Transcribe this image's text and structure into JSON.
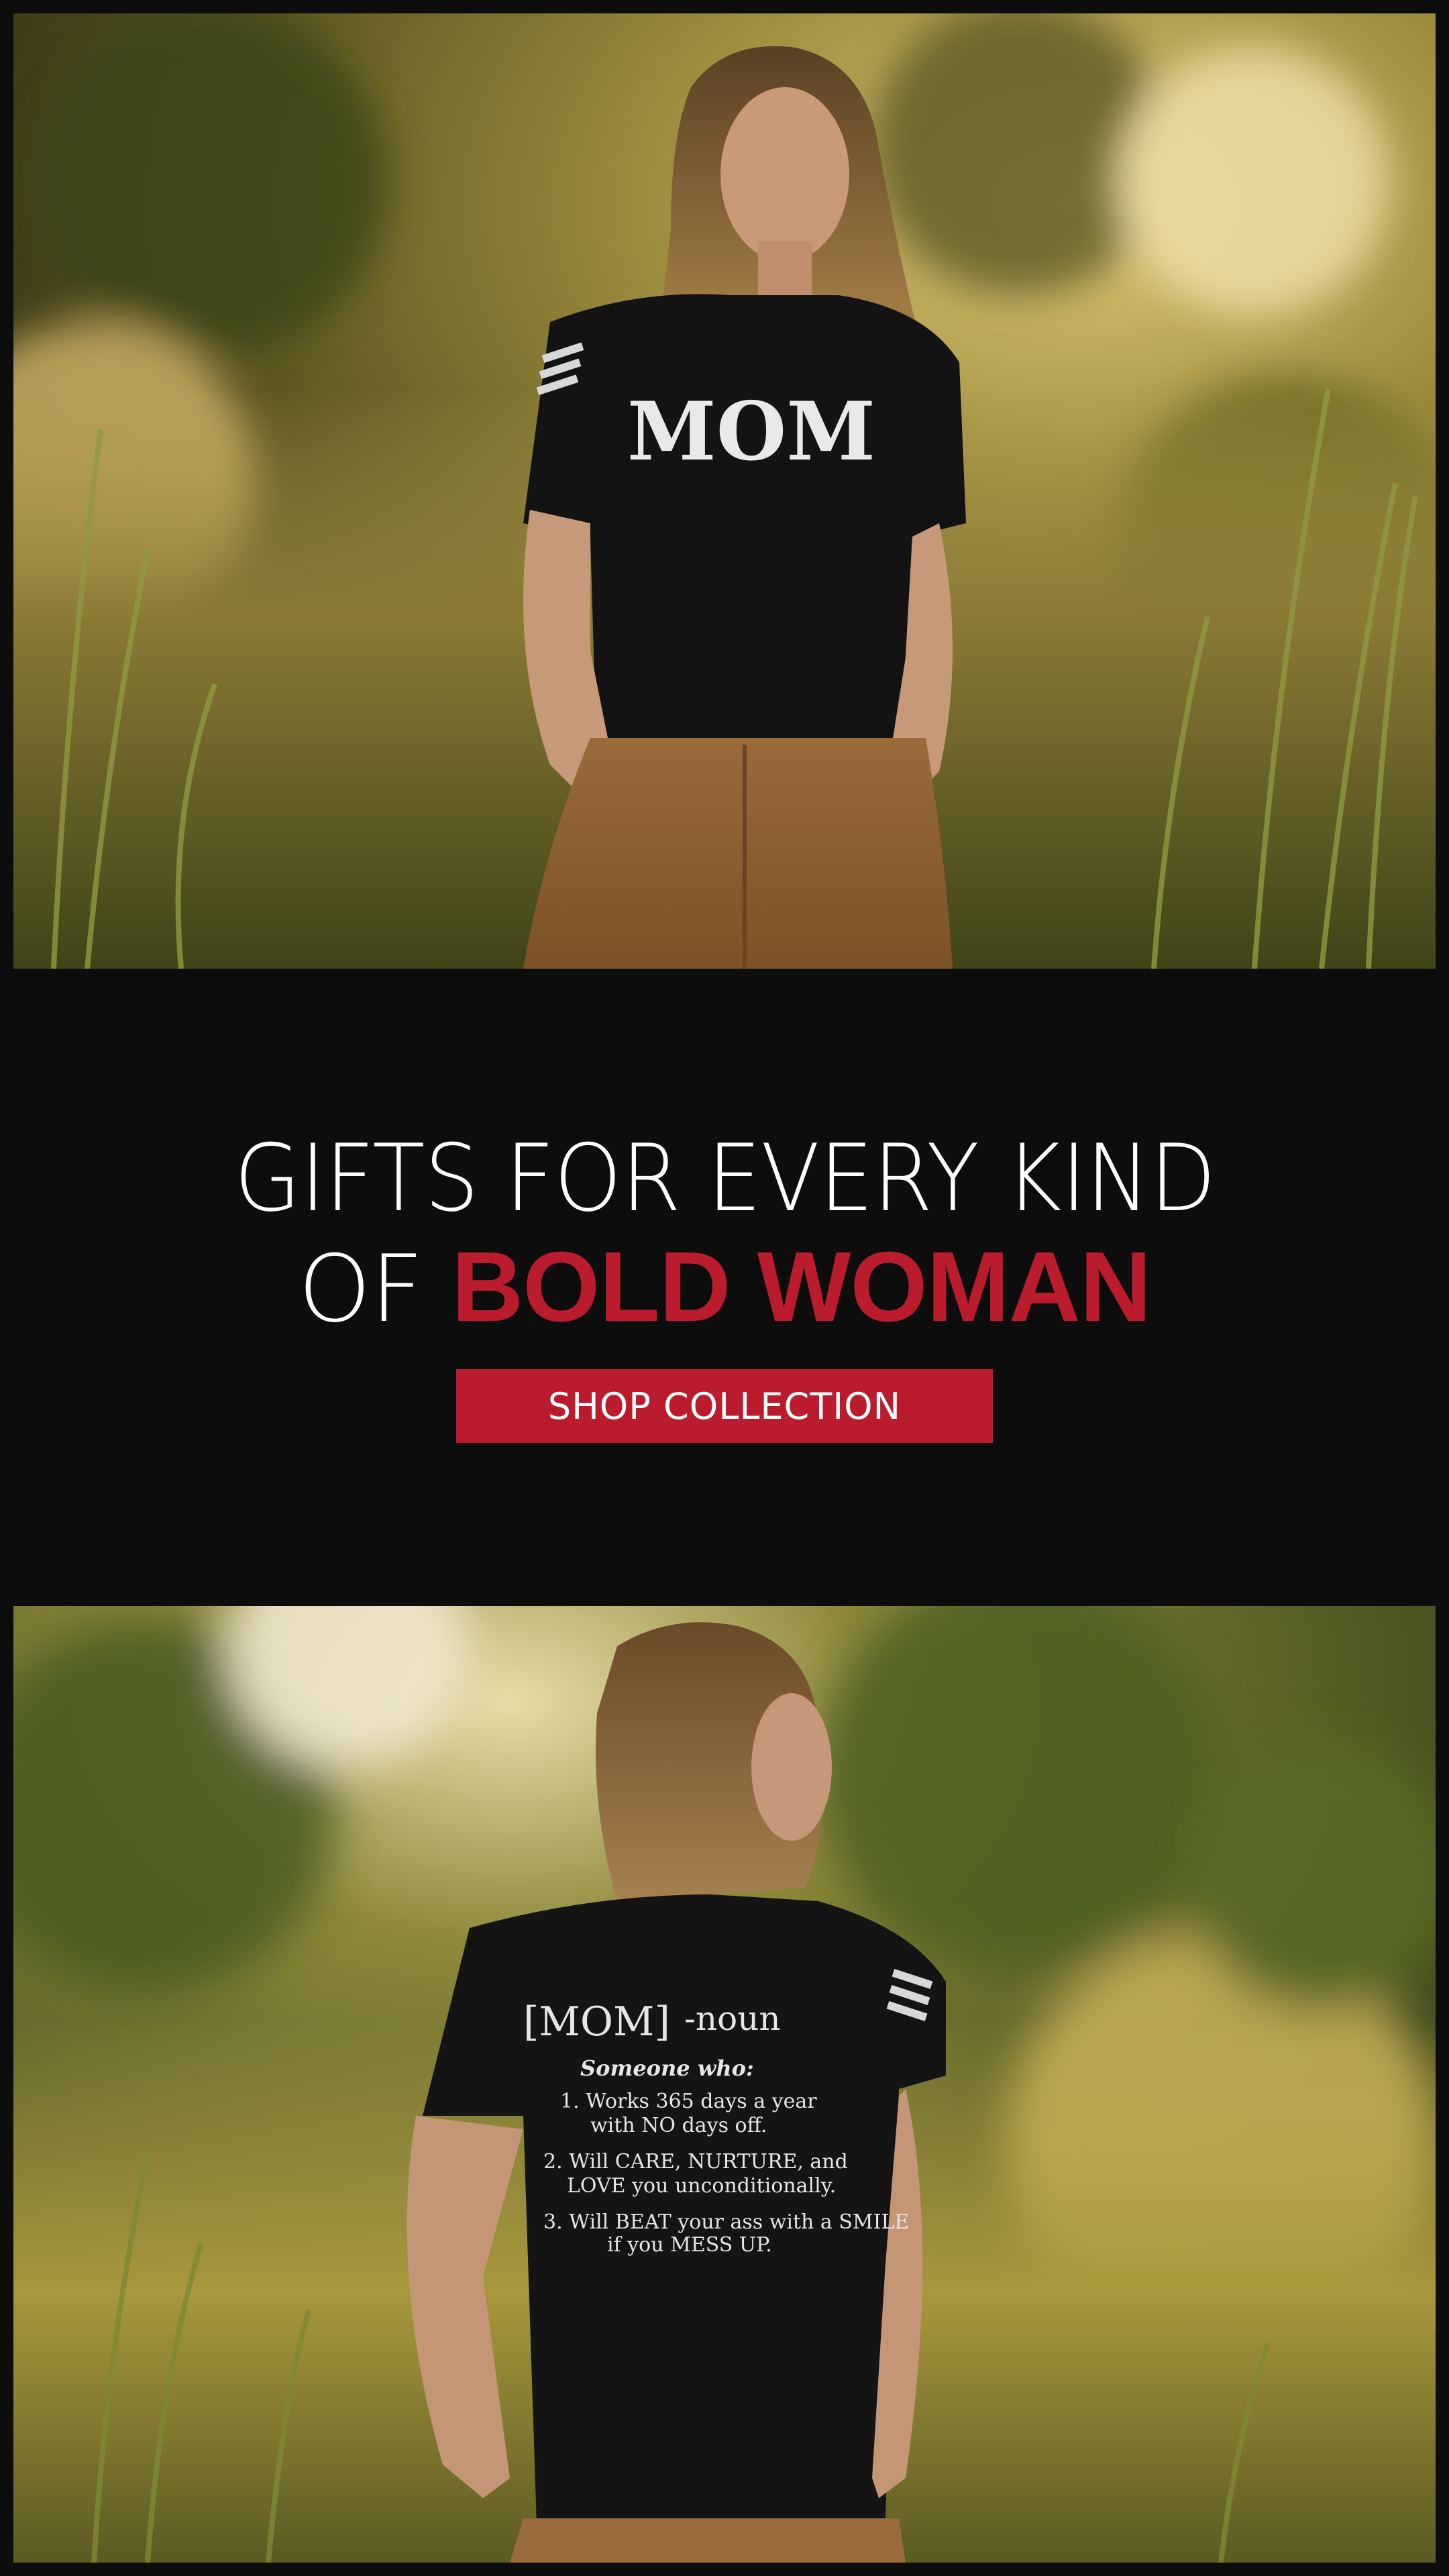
{
  "promo": {
    "headline_line1": "GIFTS FOR EVERY KIND",
    "headline_line2_prefix": "OF ",
    "headline_line2_accent": "BOLD WOMAN",
    "cta_label": "SHOP COLLECTION"
  },
  "photo_top": {
    "shirt_text": "MOM"
  },
  "photo_bottom": {
    "shirt_title": "[MOM]",
    "shirt_pos": "-noun",
    "shirt_sub": "Someone who:",
    "shirt_lines": [
      "1. Works 365 days a year",
      "with NO days off.",
      "2. Will CARE, NURTURE, and",
      "LOVE you unconditionally.",
      "3. Will BEAT your ass with a SMILE",
      "if you MESS UP."
    ]
  },
  "colors": {
    "background": "#0d0d0e",
    "accent": "#ba1c2e",
    "text": "#ffffff"
  }
}
